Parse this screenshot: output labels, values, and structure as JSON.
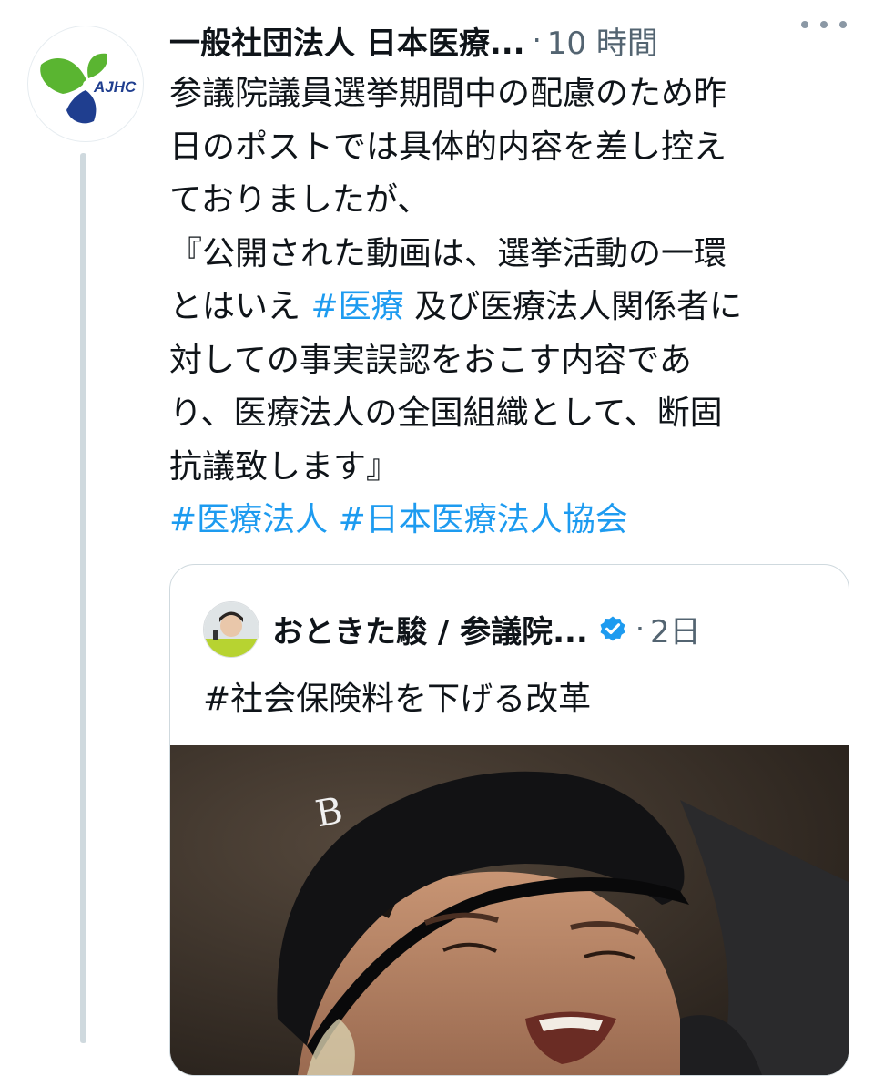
{
  "tweet": {
    "author": {
      "display_name": "一般社団法人 日本医療...",
      "avatar_text": "AJHC"
    },
    "separator": "·",
    "timestamp": "10 時間",
    "body_lines": [
      [
        {
          "t": "参議院議員選挙期間中の配慮のため昨"
        }
      ],
      [
        {
          "t": "日のポストでは具体的内容を差し控え"
        }
      ],
      [
        {
          "t": "ておりましたが、"
        }
      ],
      [
        {
          "t": "『公開された動画は、選挙活動の一環"
        }
      ],
      [
        {
          "t": "とはいえ "
        },
        {
          "t": "#医療",
          "tag": true
        },
        {
          "t": " 及び医療法人関係者に"
        }
      ],
      [
        {
          "t": "対しての事実誤認をおこす内容であ"
        }
      ],
      [
        {
          "t": "り、医療法人の全国組織として、断固"
        }
      ],
      [
        {
          "t": "抗議致します』"
        }
      ],
      [
        {
          "t": "#医療法人",
          "tag": true
        },
        {
          "t": " "
        },
        {
          "t": "#日本医療法人協会",
          "tag": true
        }
      ]
    ]
  },
  "quoted": {
    "display_name": "おときた駿 / 参議院...",
    "separator": "·",
    "timestamp": "2日",
    "text": "#社会保険料を下げる改革"
  },
  "colors": {
    "link": "#1d9bf0",
    "text": "#0f1419",
    "secondary": "#536471",
    "verified": "#1d9bf0",
    "logo_green": "#5ab531",
    "logo_navy": "#1f3e8f"
  },
  "icons": {
    "more": "more-horizontal-icon",
    "verified": "verified-badge-icon"
  }
}
